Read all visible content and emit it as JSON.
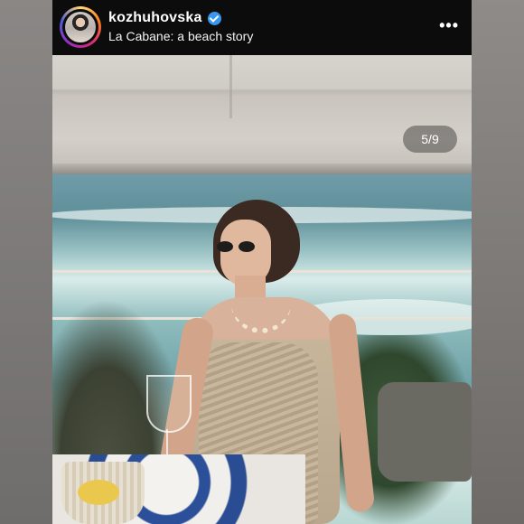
{
  "header": {
    "username": "kozhuhovska",
    "verified_icon": "verified-badge-icon",
    "location": "La Cabane: a beach story",
    "more_icon": "more-options-icon",
    "more_symbol": "•••"
  },
  "media": {
    "counter": "5/9",
    "description": "carousel-photo"
  },
  "colors": {
    "header_bg": "#0c0c0c",
    "verified_blue": "#3897f0",
    "story_ring": [
      "#feda75",
      "#fa7e1e",
      "#d62976",
      "#962fbf",
      "#4f5bd5"
    ]
  }
}
